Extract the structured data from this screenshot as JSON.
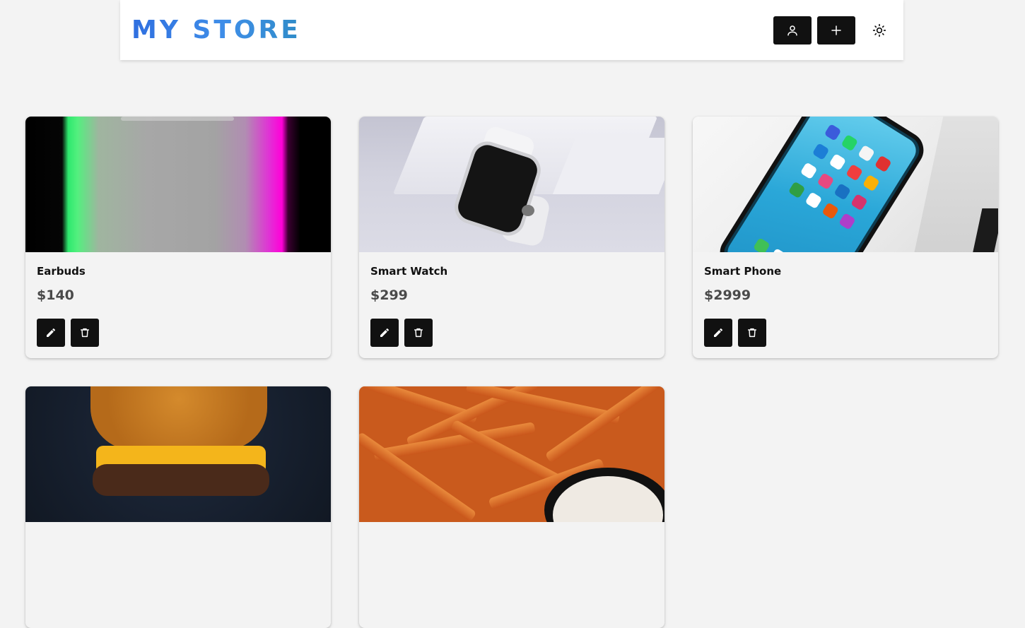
{
  "header": {
    "logo": "MY STORE",
    "buttons": [
      {
        "icon": "user-icon"
      },
      {
        "icon": "plus-icon"
      },
      {
        "icon": "sun-icon"
      }
    ]
  },
  "products": [
    {
      "name": "Earbuds",
      "price": "$140",
      "image": "earbuds"
    },
    {
      "name": "Smart Watch",
      "price": "$299",
      "image": "smart-watch"
    },
    {
      "name": "Smart Phone",
      "price": "$2999",
      "image": "smart-phone"
    },
    {
      "name": "",
      "price": "",
      "image": "burger"
    },
    {
      "name": "",
      "price": "",
      "image": "fries"
    }
  ],
  "colors": {
    "background": "#f3f3f3",
    "button": "#111111",
    "logo_gradient_start": "#2f6fe0",
    "logo_gradient_end": "#2f8cc8",
    "price": "#4a4a4a"
  }
}
